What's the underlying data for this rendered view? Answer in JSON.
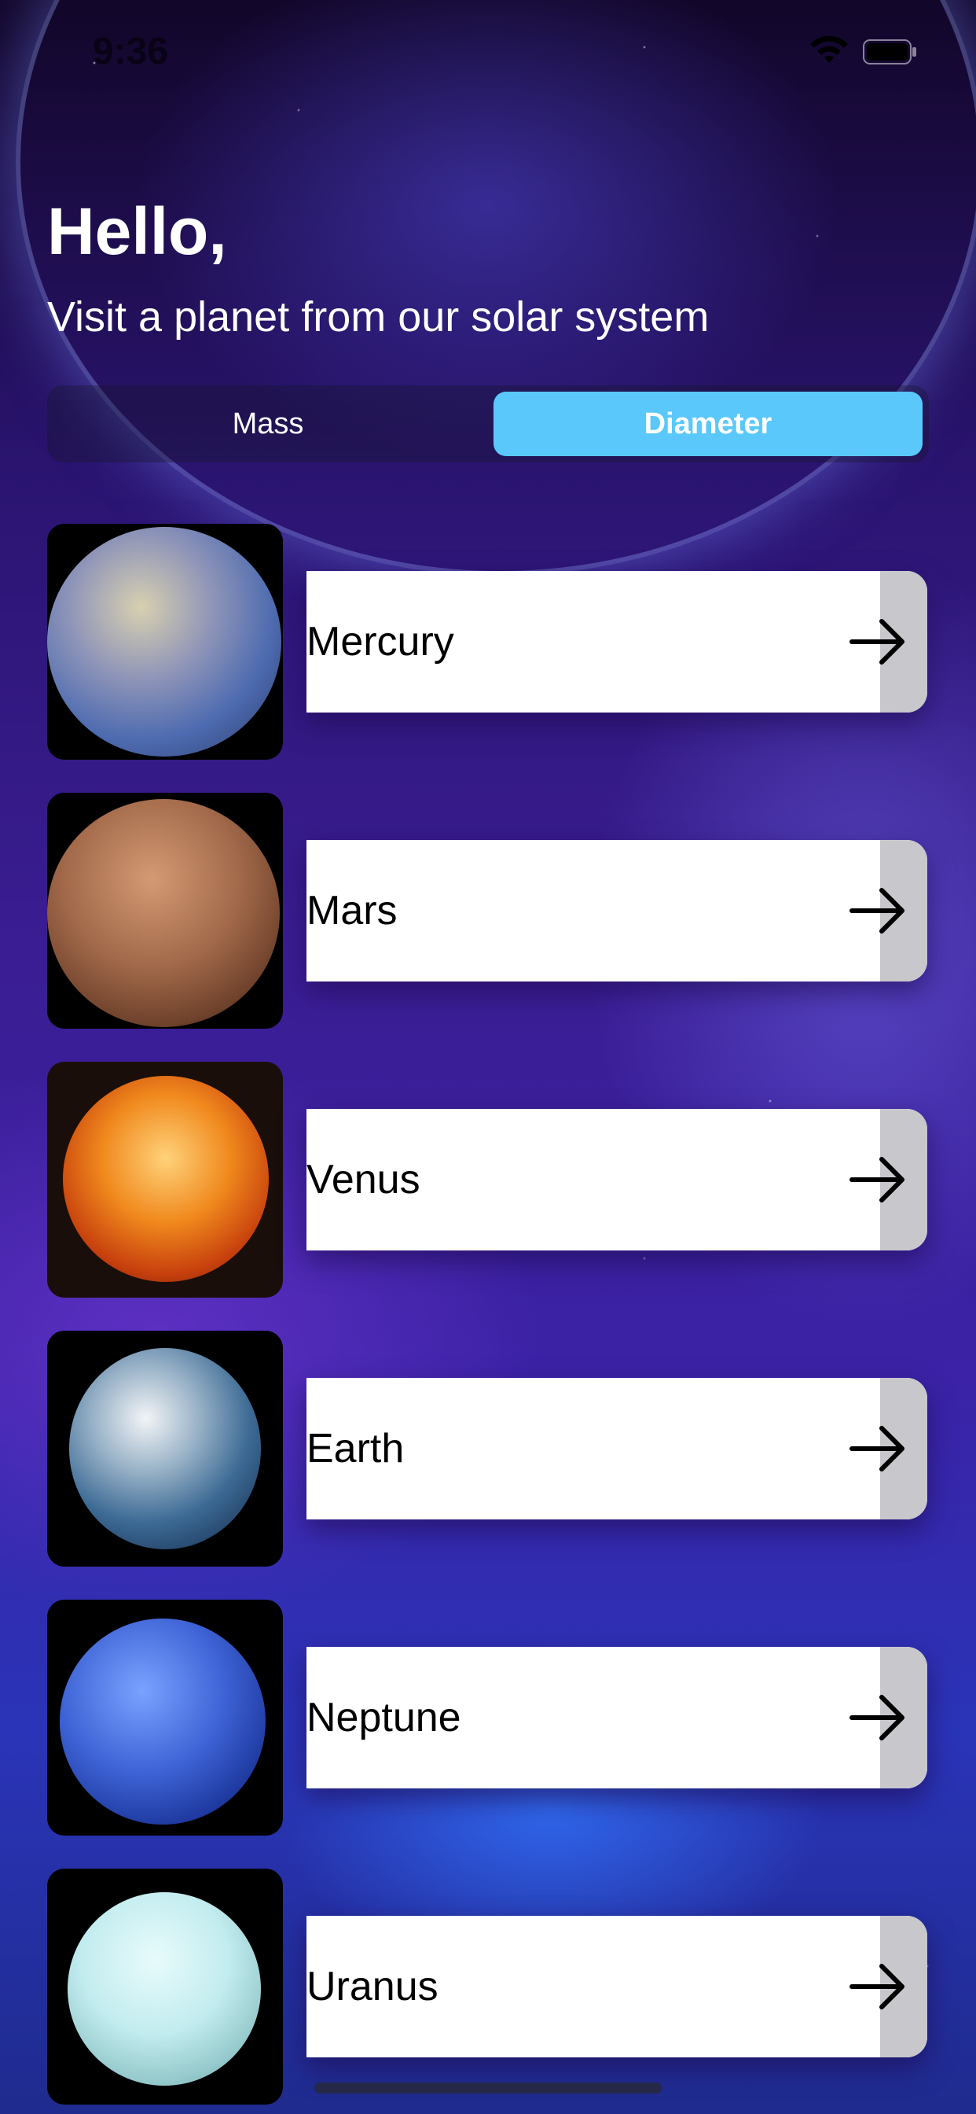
{
  "status_bar": {
    "time": "9:36",
    "wifi_icon": "wifi-icon",
    "battery_icon": "battery-icon"
  },
  "header": {
    "greeting": "Hello,",
    "subtitle": "Visit a planet from our solar system"
  },
  "sort_control": {
    "options": [
      "Mass",
      "Diameter"
    ],
    "selected": "Diameter",
    "selected_color": "#5ac8fa"
  },
  "planets": [
    {
      "name": "Mercury",
      "color": "#8a8fb0"
    },
    {
      "name": "Mars",
      "color": "#a86a4a"
    },
    {
      "name": "Venus",
      "color": "#e0661a"
    },
    {
      "name": "Earth",
      "color": "#3f6f9f"
    },
    {
      "name": "Neptune",
      "color": "#3a5fd0"
    },
    {
      "name": "Uranus",
      "color": "#bfe8ec"
    }
  ],
  "row_icon": "arrow-right-icon"
}
